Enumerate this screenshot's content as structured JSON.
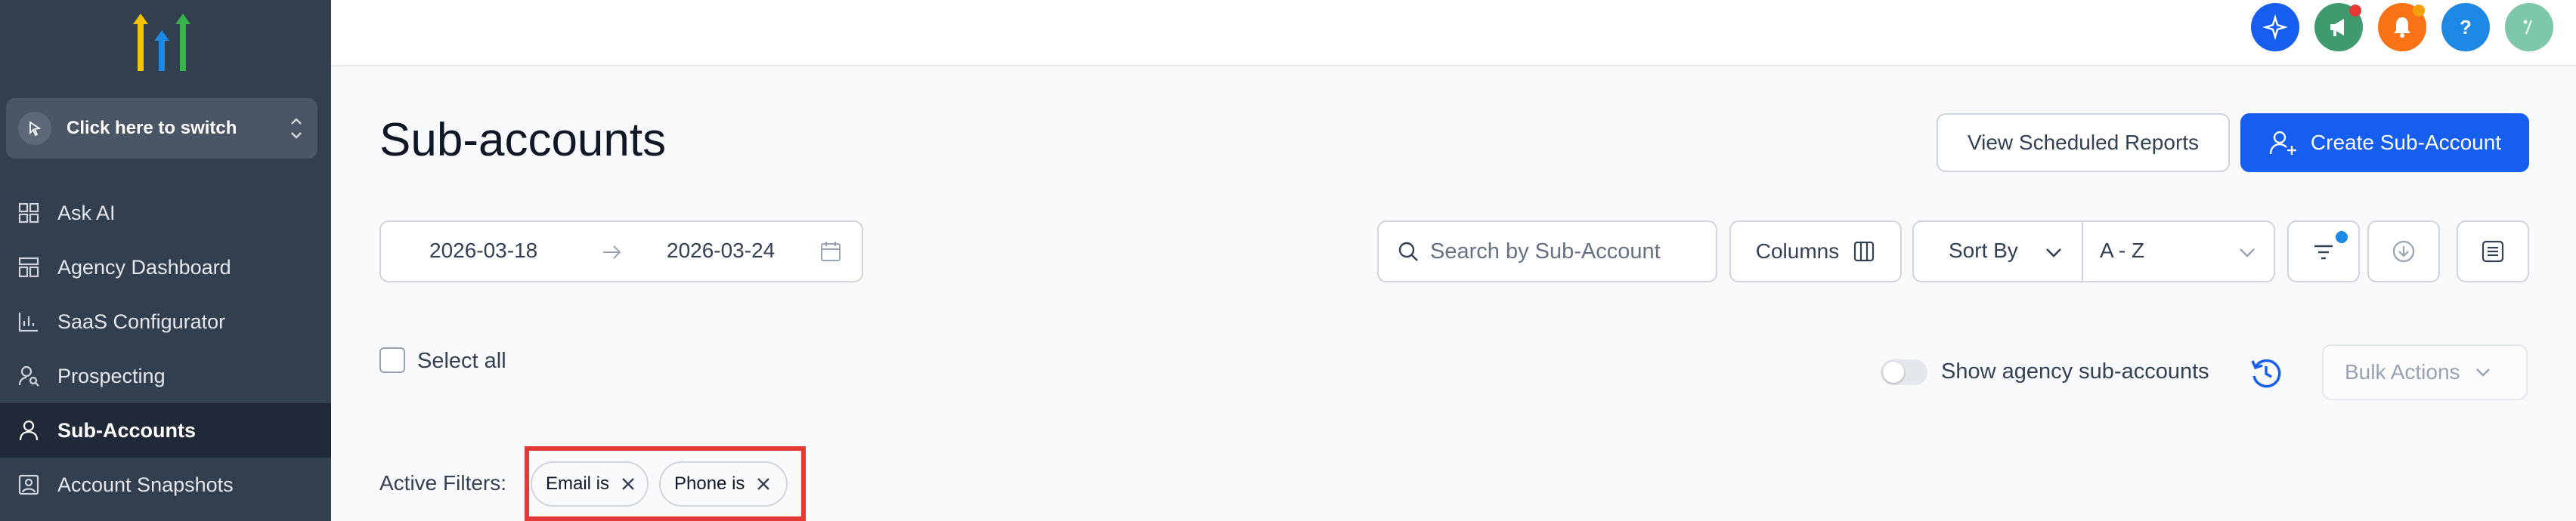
{
  "sidebar": {
    "switcher_label": "Click here to switch",
    "items": [
      {
        "label": "Ask AI",
        "icon": "grid-icon",
        "active": false
      },
      {
        "label": "Agency Dashboard",
        "icon": "dashboard-icon",
        "active": false
      },
      {
        "label": "SaaS Configurator",
        "icon": "bar-chart-icon",
        "active": false
      },
      {
        "label": "Prospecting",
        "icon": "user-search-icon",
        "active": false
      },
      {
        "label": "Sub-Accounts",
        "icon": "user-icon",
        "active": true
      },
      {
        "label": "Account Snapshots",
        "icon": "snapshot-icon",
        "active": false
      }
    ]
  },
  "header": {
    "icons": [
      {
        "name": "sparkle-icon",
        "color": "#155eef"
      },
      {
        "name": "megaphone-icon",
        "color": "#3f9a6e",
        "badge": "#e53935"
      },
      {
        "name": "bell-icon",
        "color": "#f97316",
        "badge": "#f59e0b"
      },
      {
        "name": "help-icon",
        "color": "#1e88e5"
      },
      {
        "name": "avatar",
        "color": "#7cc8a8"
      }
    ]
  },
  "page": {
    "title": "Sub-accounts",
    "view_reports_label": "View Scheduled Reports",
    "create_label": "Create Sub-Account"
  },
  "toolbar": {
    "date_start": "2026-03-18",
    "date_end": "2026-03-24",
    "search_placeholder": "Search by Sub-Account",
    "columns_label": "Columns",
    "sort_label": "Sort By",
    "sort_value": "A - Z"
  },
  "list": {
    "select_all_label": "Select all",
    "show_agency_label": "Show agency sub-accounts",
    "bulk_actions_label": "Bulk Actions"
  },
  "filters": {
    "label": "Active Filters:",
    "chips": [
      "Email is",
      "Phone is"
    ]
  },
  "colors": {
    "sidebar_bg": "#323f4f",
    "primary": "#155eef",
    "highlight": "#e53935"
  }
}
